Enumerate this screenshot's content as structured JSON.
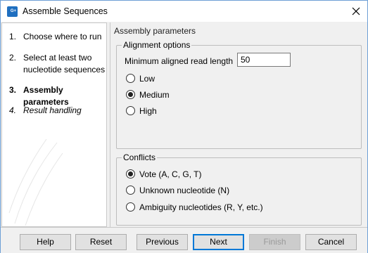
{
  "window": {
    "title": "Assemble Sequences",
    "app_icon_text": "G+"
  },
  "steps": [
    {
      "number": "1.",
      "label": "Choose where to run",
      "state": "done"
    },
    {
      "number": "2.",
      "label": "Select at least two nucleotide sequences",
      "state": "done"
    },
    {
      "number": "3.",
      "label": "Assembly parameters",
      "state": "current"
    },
    {
      "number": "4.",
      "label": "Result handling",
      "state": "future"
    }
  ],
  "content": {
    "section_title": "Assembly parameters",
    "alignment": {
      "legend": "Alignment options",
      "min_length_label": "Minimum aligned read length",
      "min_length_value": "50",
      "options": [
        "Low",
        "Medium",
        "High"
      ],
      "selected": "Medium"
    },
    "conflicts": {
      "legend": "Conflicts",
      "options": [
        "Vote (A, C, G, T)",
        "Unknown nucleotide (N)",
        "Ambiguity nucleotides (R, Y, etc.)"
      ],
      "selected": "Vote (A, C, G, T)"
    }
  },
  "buttons": {
    "help": "Help",
    "reset": "Reset",
    "previous": "Previous",
    "next": "Next",
    "finish": "Finish",
    "cancel": "Cancel"
  },
  "colors": {
    "accent": "#0078d7",
    "app_icon": "#1f6fc0"
  }
}
